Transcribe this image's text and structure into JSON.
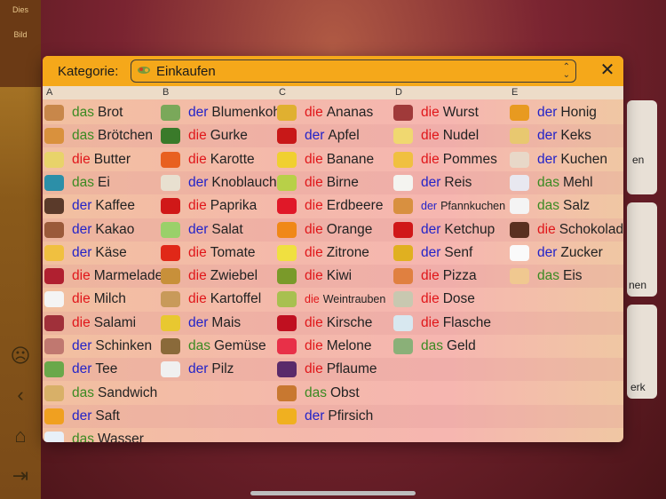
{
  "colors": {
    "der": "#2323c8",
    "die": "#e0161a",
    "das": "#3a8a22",
    "header": "#f5a81a"
  },
  "background": {
    "sidebar_texts": [
      "Dies",
      "Bild"
    ],
    "right_partial": [
      "en",
      "nen",
      "erk"
    ]
  },
  "dialog": {
    "label": "Kategorie:",
    "category": "Einkaufen",
    "close_icon": "close-icon",
    "letters": [
      "A",
      "B",
      "C",
      "D",
      "E"
    ],
    "columns": [
      [
        {
          "a": "das",
          "w": "Brot",
          "c": "#c8874a"
        },
        {
          "a": "das",
          "w": "Brötchen",
          "c": "#d9913d"
        },
        {
          "a": "die",
          "w": "Butter",
          "c": "#e8d36a"
        },
        {
          "a": "das",
          "w": "Ei",
          "c": "#2c8fa8"
        },
        {
          "a": "der",
          "w": "Kaffee",
          "c": "#5a3a2a"
        },
        {
          "a": "der",
          "w": "Kakao",
          "c": "#9a5a3a"
        },
        {
          "a": "der",
          "w": "Käse",
          "c": "#f0c040"
        },
        {
          "a": "die",
          "w": "Marmelade",
          "c": "#b02030"
        },
        {
          "a": "die",
          "w": "Milch",
          "c": "#f4f4f4"
        },
        {
          "a": "die",
          "w": "Salami",
          "c": "#a0303a"
        },
        {
          "a": "der",
          "w": "Schinken",
          "c": "#c07870"
        },
        {
          "a": "der",
          "w": "Tee",
          "c": "#6aa84a"
        },
        {
          "a": "das",
          "w": "Sandwich",
          "c": "#d8b068"
        },
        {
          "a": "der",
          "w": "Saft",
          "c": "#f0a020"
        },
        {
          "a": "das",
          "w": "Wasser",
          "c": "#e8f0f8"
        }
      ],
      [
        {
          "a": "der",
          "w": "Blumenkohl",
          "c": "#7aa85a",
          "small": false
        },
        {
          "a": "die",
          "w": "Gurke",
          "c": "#3a7a2a"
        },
        {
          "a": "die",
          "w": "Karotte",
          "c": "#e86020"
        },
        {
          "a": "der",
          "w": "Knoblauch",
          "c": "#e8e0d0"
        },
        {
          "a": "die",
          "w": "Paprika",
          "c": "#d01818"
        },
        {
          "a": "der",
          "w": "Salat",
          "c": "#9ad06a"
        },
        {
          "a": "die",
          "w": "Tomate",
          "c": "#e02818"
        },
        {
          "a": "die",
          "w": "Zwiebel",
          "c": "#c8903a"
        },
        {
          "a": "die",
          "w": "Kartoffel",
          "c": "#c89a5a"
        },
        {
          "a": "der",
          "w": "Mais",
          "c": "#e8c830"
        },
        {
          "a": "das",
          "w": "Gemüse",
          "c": "#8a6a3a"
        },
        {
          "a": "der",
          "w": "Pilz",
          "c": "#f0f0f0"
        }
      ],
      [
        {
          "a": "die",
          "w": "Ananas",
          "c": "#e0b030"
        },
        {
          "a": "der",
          "w": "Apfel",
          "c": "#c81818"
        },
        {
          "a": "die",
          "w": "Banane",
          "c": "#f0d030"
        },
        {
          "a": "die",
          "w": "Birne",
          "c": "#b8d048"
        },
        {
          "a": "die",
          "w": "Erdbeere",
          "c": "#e01828"
        },
        {
          "a": "die",
          "w": "Orange",
          "c": "#f08818"
        },
        {
          "a": "die",
          "w": "Zitrone",
          "c": "#f0e040"
        },
        {
          "a": "die",
          "w": "Kiwi",
          "c": "#7a9a2a"
        },
        {
          "a": "die",
          "w": "Weintrauben",
          "c": "#a8c050",
          "small": true
        },
        {
          "a": "die",
          "w": "Kirsche",
          "c": "#c01020"
        },
        {
          "a": "die",
          "w": "Melone",
          "c": "#e83048"
        },
        {
          "a": "die",
          "w": "Pflaume",
          "c": "#5a2a6a"
        },
        {
          "a": "das",
          "w": "Obst",
          "c": "#c87830"
        },
        {
          "a": "der",
          "w": "Pfirsich",
          "c": "#f0b020"
        }
      ],
      [
        {
          "a": "die",
          "w": "Wurst",
          "c": "#a03a3a"
        },
        {
          "a": "die",
          "w": "Nudel",
          "c": "#f0d870"
        },
        {
          "a": "die",
          "w": "Pommes",
          "c": "#f0c040"
        },
        {
          "a": "der",
          "w": "Reis",
          "c": "#f4f4f0"
        },
        {
          "a": "der",
          "w": "Pfannkuchen",
          "c": "#d89040",
          "small": true
        },
        {
          "a": "der",
          "w": "Ketchup",
          "c": "#d01818"
        },
        {
          "a": "der",
          "w": "Senf",
          "c": "#e0b020"
        },
        {
          "a": "die",
          "w": "Pizza",
          "c": "#e08040"
        },
        {
          "a": "die",
          "w": "Dose",
          "c": "#c8c8b0"
        },
        {
          "a": "die",
          "w": "Flasche",
          "c": "#d8e8f0"
        },
        {
          "a": "das",
          "w": "Geld",
          "c": "#8ab078"
        }
      ],
      [
        {
          "a": "der",
          "w": "Honig",
          "c": "#e89a20"
        },
        {
          "a": "der",
          "w": "Keks",
          "c": "#e8c870"
        },
        {
          "a": "der",
          "w": "Kuchen",
          "c": "#e8d8c8"
        },
        {
          "a": "das",
          "w": "Mehl",
          "c": "#e8e8f0"
        },
        {
          "a": "das",
          "w": "Salz",
          "c": "#f4f4f4"
        },
        {
          "a": "die",
          "w": "Schokolade",
          "c": "#5a3020"
        },
        {
          "a": "der",
          "w": "Zucker",
          "c": "#fafafa"
        },
        {
          "a": "das",
          "w": "Eis",
          "c": "#f0c890"
        }
      ]
    ]
  }
}
